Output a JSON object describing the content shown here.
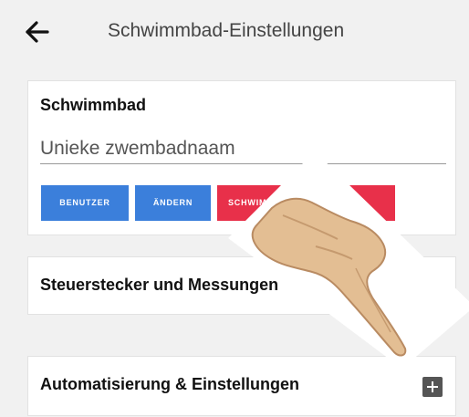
{
  "header": {
    "title": "Schwimmbad-Einstellungen"
  },
  "pool_card": {
    "title": "Schwimmbad",
    "name_placeholder": "Unieke zwembadnaam",
    "buttons": [
      "BENUTZER",
      "ÄNDERN",
      "SCHWIMMBAD"
    ]
  },
  "sections": [
    {
      "title": "Steuerstecker und Messungen"
    },
    {
      "title": "Automatisierung & Einstellungen"
    }
  ],
  "colors": {
    "primary": "#3b7fdb",
    "danger": "#e8304a",
    "background": "#f1f1f1"
  },
  "icons": {
    "back": "arrow-left-icon",
    "expand": "plus-square-icon",
    "hint": "pointing-hand-icon"
  }
}
